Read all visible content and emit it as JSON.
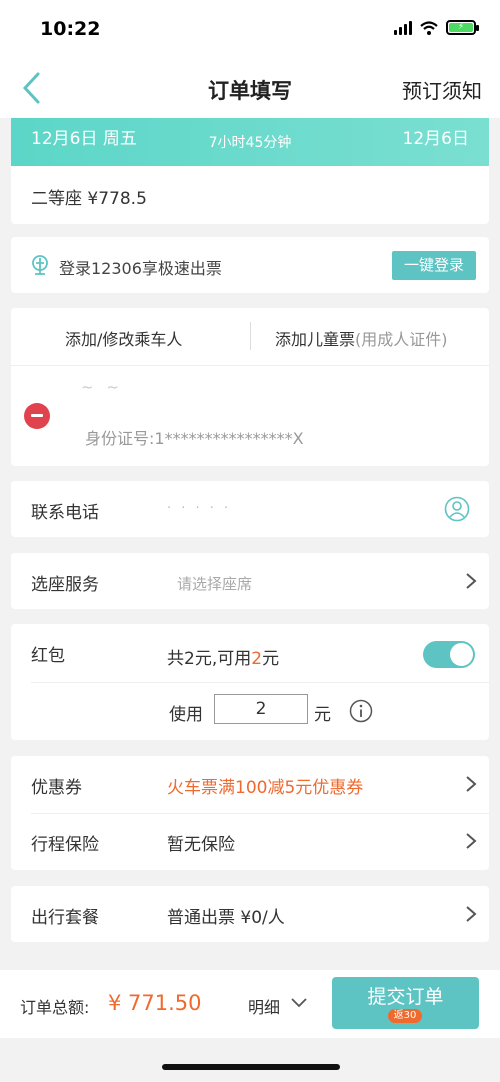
{
  "status_bar": {
    "time": "10:22"
  },
  "nav": {
    "title": "订单填写",
    "right_link": "预订须知"
  },
  "train": {
    "depart_date": "12月6日 周五",
    "duration": "7小时45分钟",
    "arrive_date": "12月6日"
  },
  "seat": {
    "label": "二等座 ¥778.5"
  },
  "login": {
    "text": "登录12306享极速出票",
    "button": "一键登录"
  },
  "passenger": {
    "add_passenger": "添加/修改乘车人",
    "add_child": "添加儿童票",
    "add_child_note": "(用成人证件)",
    "name_masked": "~ ~",
    "id_number": "身份证号:1****************X"
  },
  "contact": {
    "label": "联系电话",
    "value_masked": "· ·  ·  · ·"
  },
  "seat_service": {
    "label": "选座服务",
    "placeholder": "请选择座席"
  },
  "red_packet": {
    "label": "红包",
    "desc_prefix": "共2元,可用",
    "desc_amount": "2",
    "desc_suffix": "元",
    "use_label": "使用",
    "use_value": "2",
    "unit": "元",
    "enabled": true
  },
  "coupon": {
    "label": "优惠券",
    "value": "火车票满100减5元优惠券"
  },
  "insurance": {
    "label": "行程保险",
    "value": "暂无保险"
  },
  "package": {
    "label": "出行套餐",
    "value": "普通出票 ¥0/人"
  },
  "bottom_bar": {
    "total_label": "订单总额:",
    "total_price": "¥ 771.50",
    "detail": "明细",
    "submit": "提交订单",
    "submit_badge": "返30"
  },
  "colors": {
    "accent": "#5ec3c3",
    "price": "#f06a2e",
    "remove": "#e0424e"
  }
}
